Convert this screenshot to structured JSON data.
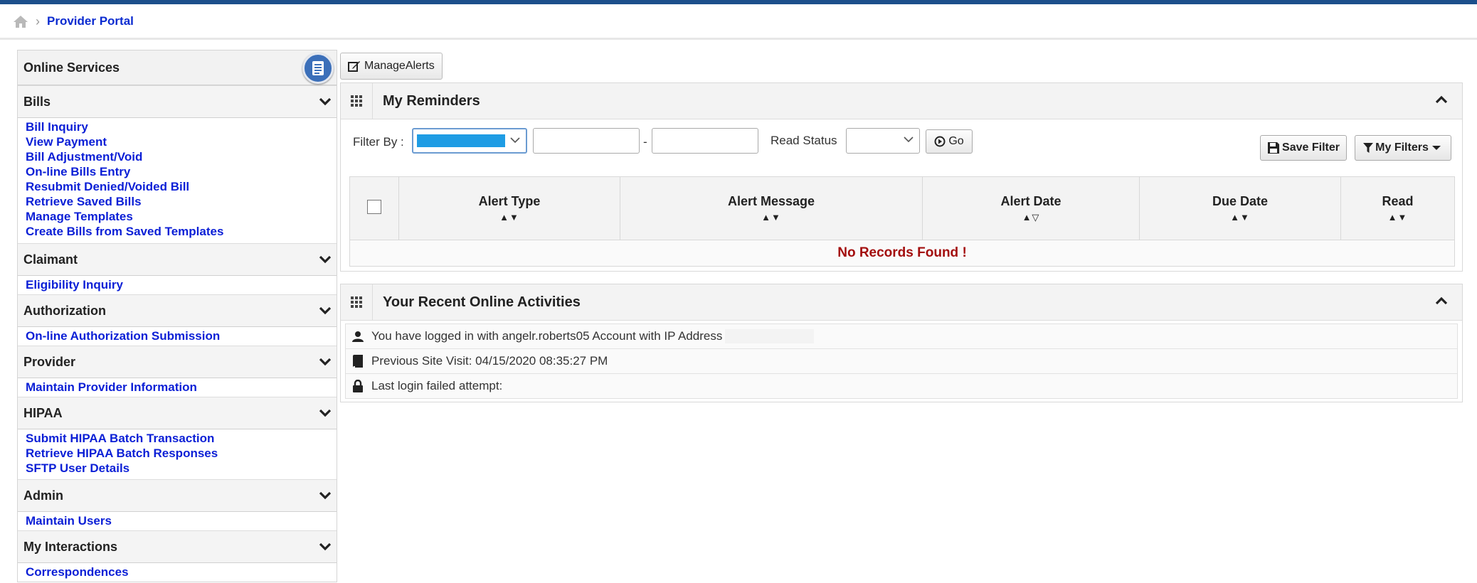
{
  "breadcrumb": {
    "home_icon": "home-icon",
    "current": "Provider Portal"
  },
  "sidebar": {
    "title": "Online Services",
    "sections": [
      {
        "label": "Bills",
        "links": [
          "Bill Inquiry",
          "View Payment",
          "Bill Adjustment/Void",
          "On-line Bills Entry",
          "Resubmit Denied/Voided Bill",
          "Retrieve Saved Bills",
          "Manage Templates",
          "Create Bills from Saved Templates"
        ]
      },
      {
        "label": "Claimant",
        "links": [
          "Eligibility Inquiry"
        ]
      },
      {
        "label": "Authorization",
        "links": [
          "On-line Authorization Submission"
        ]
      },
      {
        "label": "Provider",
        "links": [
          "Maintain Provider Information"
        ]
      },
      {
        "label": "HIPAA",
        "links": [
          "Submit HIPAA Batch Transaction",
          "Retrieve HIPAA Batch Responses",
          "SFTP User Details"
        ]
      },
      {
        "label": "Admin",
        "links": [
          "Maintain Users"
        ]
      },
      {
        "label": "My Interactions",
        "links": [
          "Correspondences"
        ]
      }
    ]
  },
  "toolbar": {
    "manage_alerts": "ManageAlerts"
  },
  "reminders": {
    "title": "My Reminders",
    "filter_by_label": "Filter By :",
    "dash": "-",
    "read_status_label": "Read Status",
    "go_label": "Go",
    "save_filter_label": "Save Filter",
    "my_filters_label": "My Filters",
    "columns": [
      "Alert Type",
      "Alert Message",
      "Alert Date",
      "Due Date",
      "Read"
    ],
    "sort_indicators": [
      "▲▼",
      "▲▼",
      "▲▽",
      "▲▼",
      "▲▼"
    ],
    "empty_message": "No Records Found !"
  },
  "activities": {
    "title": "Your Recent Online Activities",
    "rows": [
      {
        "icon": "user-icon",
        "text": "You have logged in with angelr.roberts05 Account with IP Address"
      },
      {
        "icon": "document-icon",
        "text": "Previous Site Visit: 04/15/2020 08:35:27 PM"
      },
      {
        "icon": "lock-icon",
        "text": "Last login failed attempt:"
      }
    ]
  },
  "colors": {
    "link": "#0b1fd6",
    "header_bar": "#1c4f8b",
    "alert_text": "#a30d0d",
    "select_highlight": "#1e9ce4"
  }
}
